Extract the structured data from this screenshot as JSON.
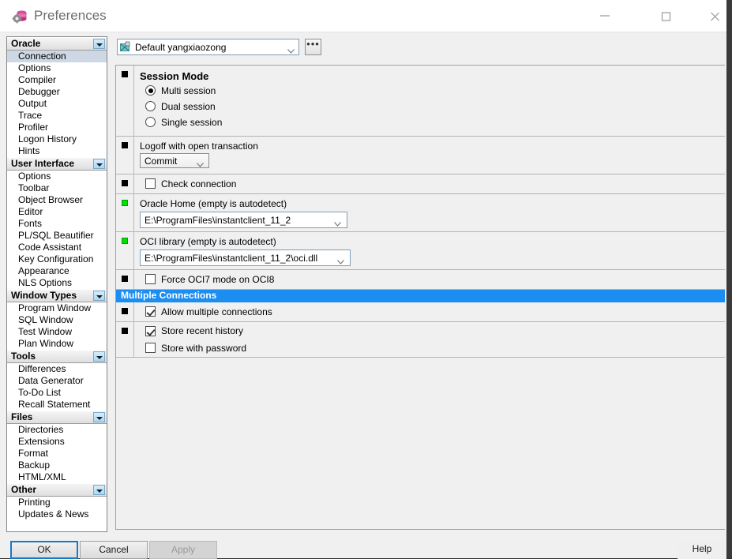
{
  "window": {
    "title": "Preferences",
    "icon": "database-preferences-icon",
    "controls": {
      "minimize": "minimize-icon",
      "maximize": "maximize-icon",
      "close": "close-icon"
    }
  },
  "sidebar": {
    "groups": [
      {
        "header": "Oracle",
        "items": [
          {
            "label": "Connection",
            "selected": true
          },
          {
            "label": "Options",
            "selected": false
          },
          {
            "label": "Compiler",
            "selected": false
          },
          {
            "label": "Debugger",
            "selected": false
          },
          {
            "label": "Output",
            "selected": false
          },
          {
            "label": "Trace",
            "selected": false
          },
          {
            "label": "Profiler",
            "selected": false
          },
          {
            "label": "Logon History",
            "selected": false
          },
          {
            "label": "Hints",
            "selected": false
          }
        ]
      },
      {
        "header": "User Interface",
        "items": [
          {
            "label": "Options",
            "selected": false
          },
          {
            "label": "Toolbar",
            "selected": false
          },
          {
            "label": "Object Browser",
            "selected": false
          },
          {
            "label": "Editor",
            "selected": false
          },
          {
            "label": "Fonts",
            "selected": false
          },
          {
            "label": "PL/SQL Beautifier",
            "selected": false
          },
          {
            "label": "Code Assistant",
            "selected": false
          },
          {
            "label": "Key Configuration",
            "selected": false
          },
          {
            "label": "Appearance",
            "selected": false
          },
          {
            "label": "NLS Options",
            "selected": false
          }
        ]
      },
      {
        "header": "Window Types",
        "items": [
          {
            "label": "Program Window",
            "selected": false
          },
          {
            "label": "SQL Window",
            "selected": false
          },
          {
            "label": "Test Window",
            "selected": false
          },
          {
            "label": "Plan Window",
            "selected": false
          }
        ]
      },
      {
        "header": "Tools",
        "items": [
          {
            "label": "Differences",
            "selected": false
          },
          {
            "label": "Data Generator",
            "selected": false
          },
          {
            "label": "To-Do List",
            "selected": false
          },
          {
            "label": "Recall Statement",
            "selected": false
          }
        ]
      },
      {
        "header": "Files",
        "items": [
          {
            "label": "Directories",
            "selected": false
          },
          {
            "label": "Extensions",
            "selected": false
          },
          {
            "label": "Format",
            "selected": false
          },
          {
            "label": "Backup",
            "selected": false
          },
          {
            "label": "HTML/XML",
            "selected": false
          }
        ]
      },
      {
        "header": "Other",
        "items": [
          {
            "label": "Printing",
            "selected": false
          },
          {
            "label": "Updates & News",
            "selected": false
          }
        ]
      }
    ]
  },
  "profile": {
    "icon": "profile-icon",
    "value": "Default yangxiaozong",
    "dropdown_icon": "chevron-down-icon",
    "browse_label": "•••"
  },
  "settings": {
    "session_mode": {
      "marker": "black",
      "title": "Session Mode",
      "options": [
        {
          "label": "Multi session",
          "checked": true
        },
        {
          "label": "Dual session",
          "checked": false
        },
        {
          "label": "Single session",
          "checked": false
        }
      ]
    },
    "logoff": {
      "marker": "black",
      "label": "Logoff with open transaction",
      "value": "Commit"
    },
    "check_connection": {
      "marker": "black",
      "label": "Check connection",
      "checked": false
    },
    "oracle_home": {
      "marker": "green",
      "label": "Oracle Home (empty is autodetect)",
      "value": "E:\\ProgramFiles\\instantclient_11_2"
    },
    "oci_library": {
      "marker": "green",
      "label": "OCI library (empty is autodetect)",
      "value": "E:\\ProgramFiles\\instantclient_11_2\\oci.dll"
    },
    "force_oci7": {
      "marker": "black",
      "label": "Force OCI7 mode on OCI8",
      "checked": false
    },
    "multiple_connections_banner": "Multiple Connections",
    "allow_multiple": {
      "marker": "black",
      "label": "Allow multiple connections",
      "checked": true
    },
    "history": {
      "marker": "black",
      "store_recent": {
        "label": "Store recent history",
        "checked": true
      },
      "store_password": {
        "label": "Store with password",
        "checked": false
      }
    }
  },
  "buttons": {
    "ok": "OK",
    "cancel": "Cancel",
    "apply": "Apply",
    "help": "Help"
  },
  "colors": {
    "accent_blue": "#1c8ef2",
    "focus_blue": "#1878c8",
    "marker_green": "#00e000",
    "selection": "#cdd8e4"
  }
}
